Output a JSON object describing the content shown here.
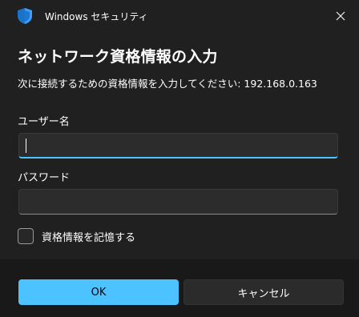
{
  "window": {
    "title": "Windows セキュリティ",
    "icon": "shield-icon",
    "close_icon": "close-icon"
  },
  "dialog": {
    "heading": "ネットワーク資格情報の入力",
    "description": "次に接続するための資格情報を入力してください: 192.168.0.163"
  },
  "form": {
    "username_label": "ユーザー名",
    "username_value": "",
    "password_label": "パスワード",
    "password_value": "",
    "remember_label": "資格情報を記憶する",
    "remember_checked": false
  },
  "buttons": {
    "ok_label": "OK",
    "cancel_label": "キャンセル"
  },
  "colors": {
    "background": "#202020",
    "footer": "#191919",
    "accent": "#4cc2ff",
    "input_bg": "#2c2c2c",
    "cancel_bg": "#2b2b2b"
  }
}
